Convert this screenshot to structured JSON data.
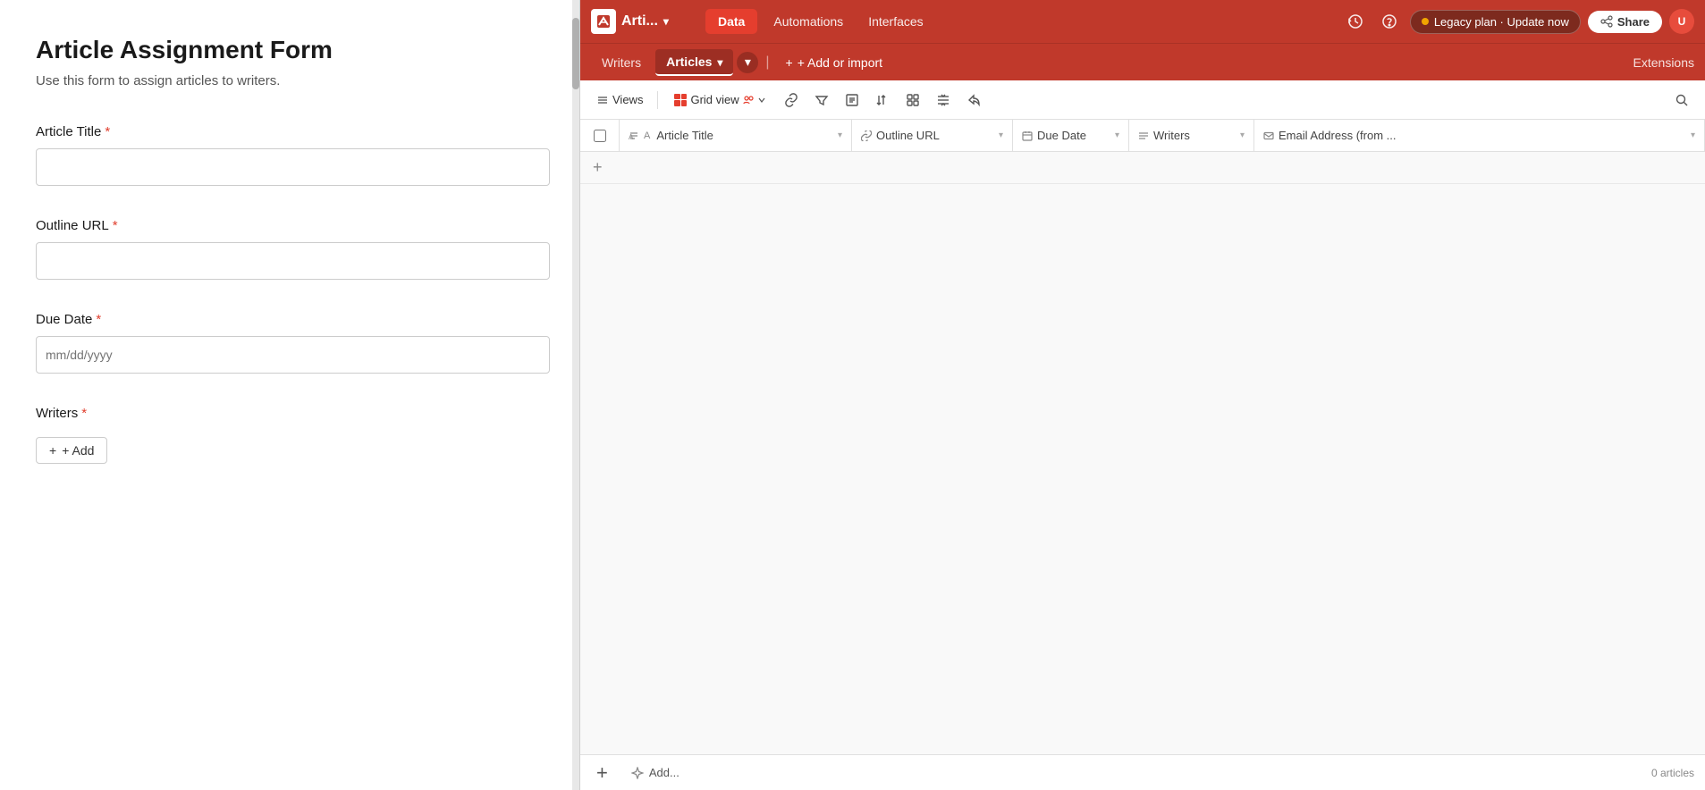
{
  "app": {
    "name": "Arti...",
    "full_name": "Article Assignment Form"
  },
  "left_panel": {
    "title": "Article Assignment Form",
    "subtitle": "Use this form to assign articles to writers.",
    "fields": [
      {
        "id": "article_title",
        "label": "Article Title",
        "required": true,
        "type": "text",
        "placeholder": "",
        "value": ""
      },
      {
        "id": "outline_url",
        "label": "Outline URL",
        "required": true,
        "type": "text",
        "placeholder": "",
        "value": ""
      },
      {
        "id": "due_date",
        "label": "Due Date",
        "required": true,
        "type": "date",
        "placeholder": "mm/dd/yyyy",
        "value": ""
      },
      {
        "id": "writers",
        "label": "Writers",
        "required": true,
        "type": "add",
        "add_label": "+ Add"
      }
    ]
  },
  "topbar": {
    "app_name": "Arti...",
    "nav_items": [
      {
        "id": "data",
        "label": "Data",
        "active": true
      },
      {
        "id": "automations",
        "label": "Automations",
        "active": false
      },
      {
        "id": "interfaces",
        "label": "Interfaces",
        "active": false
      }
    ],
    "legacy_badge": "Legacy plan · Update now",
    "share_label": "Share"
  },
  "secondbar": {
    "tabs": [
      {
        "id": "writers",
        "label": "Writers",
        "active": false
      },
      {
        "id": "articles",
        "label": "Articles",
        "active": true
      }
    ],
    "add_import_label": "+ Add or import",
    "extensions_label": "Extensions"
  },
  "toolbar": {
    "views_label": "Views",
    "grid_view_label": "Grid view"
  },
  "table": {
    "columns": [
      {
        "id": "article_title",
        "label": "Article Title",
        "icon": "text-icon"
      },
      {
        "id": "outline_url",
        "label": "Outline URL",
        "icon": "link-icon"
      },
      {
        "id": "due_date",
        "label": "Due Date",
        "icon": "calendar-icon"
      },
      {
        "id": "writers",
        "label": "Writers",
        "icon": "list-icon"
      },
      {
        "id": "email_address",
        "label": "Email Address (from ...",
        "icon": "email-icon"
      }
    ],
    "rows": [],
    "record_count": "0 articles"
  },
  "bottom_bar": {
    "add_label": "+",
    "ai_label": "Add...",
    "record_count": "0 articles"
  }
}
